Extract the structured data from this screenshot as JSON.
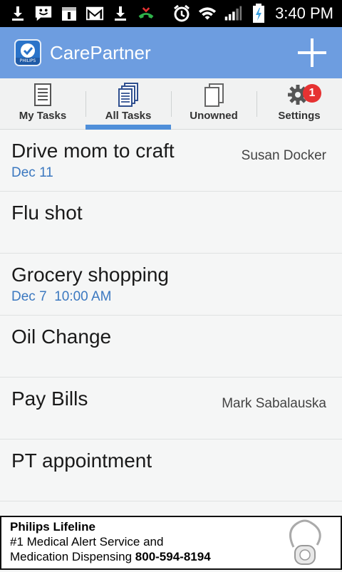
{
  "status_bar": {
    "time": "3:40 PM",
    "icons_left": [
      "download-icon",
      "smiley-message-icon",
      "calendar-icon",
      "gmail-icon",
      "download-icon",
      "missed-call-icon"
    ],
    "icons_right": [
      "alarm-icon",
      "wifi-icon",
      "signal-icon",
      "battery-charging-icon"
    ]
  },
  "app_bar": {
    "title": "CarePartner",
    "logo_text": "PHILIPS",
    "add_icon": "plus-icon"
  },
  "tabs": [
    {
      "label": "My Tasks",
      "icon": "single-document-icon",
      "active": false
    },
    {
      "label": "All Tasks",
      "icon": "stacked-documents-icon",
      "active": true
    },
    {
      "label": "Unowned",
      "icon": "double-document-icon",
      "active": false
    },
    {
      "label": "Settings",
      "icon": "gear-icon",
      "active": false,
      "badge": "1"
    }
  ],
  "tasks": [
    {
      "title": "Drive mom to craft",
      "owner": "Susan Docker",
      "date": "Dec 11"
    },
    {
      "title": "Flu shot",
      "owner": "",
      "date": ""
    },
    {
      "title": "Grocery shopping",
      "owner": "",
      "date": "Dec 7  10:00 AM"
    },
    {
      "title": "Oil Change",
      "owner": "",
      "date": ""
    },
    {
      "title": "Pay Bills",
      "owner": "Mark Sabalauska",
      "date": ""
    },
    {
      "title": "PT appointment",
      "owner": "",
      "date": ""
    }
  ],
  "ad": {
    "title": "Philips Lifeline",
    "line1": "#1 Medical Alert Service and",
    "line2": "Medication Dispensing",
    "phone": "800-594-8194"
  },
  "colors": {
    "app_bar": "#6d9de0",
    "accent": "#4f8fd9",
    "date_text": "#3b78c0",
    "badge": "#e63232"
  }
}
